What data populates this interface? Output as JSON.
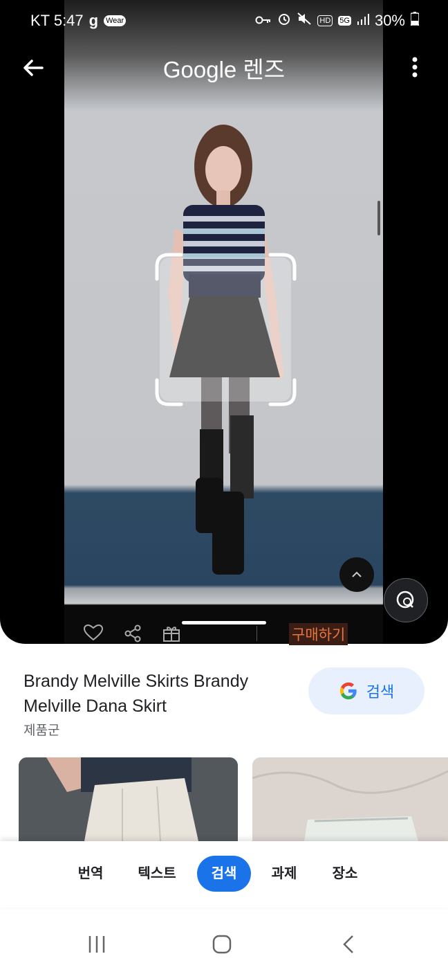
{
  "status_bar": {
    "carrier_time": "KT 5:47",
    "battery": "30%",
    "icons": [
      "g-app-icon",
      "wear-icon",
      "key-icon",
      "alarm-icon",
      "mute-icon",
      "hd-icon",
      "5g-icon",
      "signal-icon",
      "battery-icon"
    ],
    "hd_label": "HD",
    "network_label": "5G",
    "wear_label": "Wear"
  },
  "app_bar": {
    "title": "Google 렌즈",
    "back_icon": "arrow-left-icon",
    "menu_icon": "more-vert-icon"
  },
  "image_viewer": {
    "buy_label": "구매하기",
    "toolbar_icons": [
      "heart-icon",
      "share-icon",
      "gift-icon"
    ]
  },
  "result": {
    "title": "Brandy Melville Skirts Brandy Melville Dana Skirt",
    "subtitle": "제품군",
    "search_button_label": "검색"
  },
  "tabs": [
    {
      "label": "번역",
      "active": false
    },
    {
      "label": "텍스트",
      "active": false
    },
    {
      "label": "검색",
      "active": true
    },
    {
      "label": "과제",
      "active": false
    },
    {
      "label": "장소",
      "active": false
    }
  ],
  "colors": {
    "accent": "#1a73e8",
    "buy": "#e8763f",
    "chip_bg": "#e8f0fe"
  }
}
